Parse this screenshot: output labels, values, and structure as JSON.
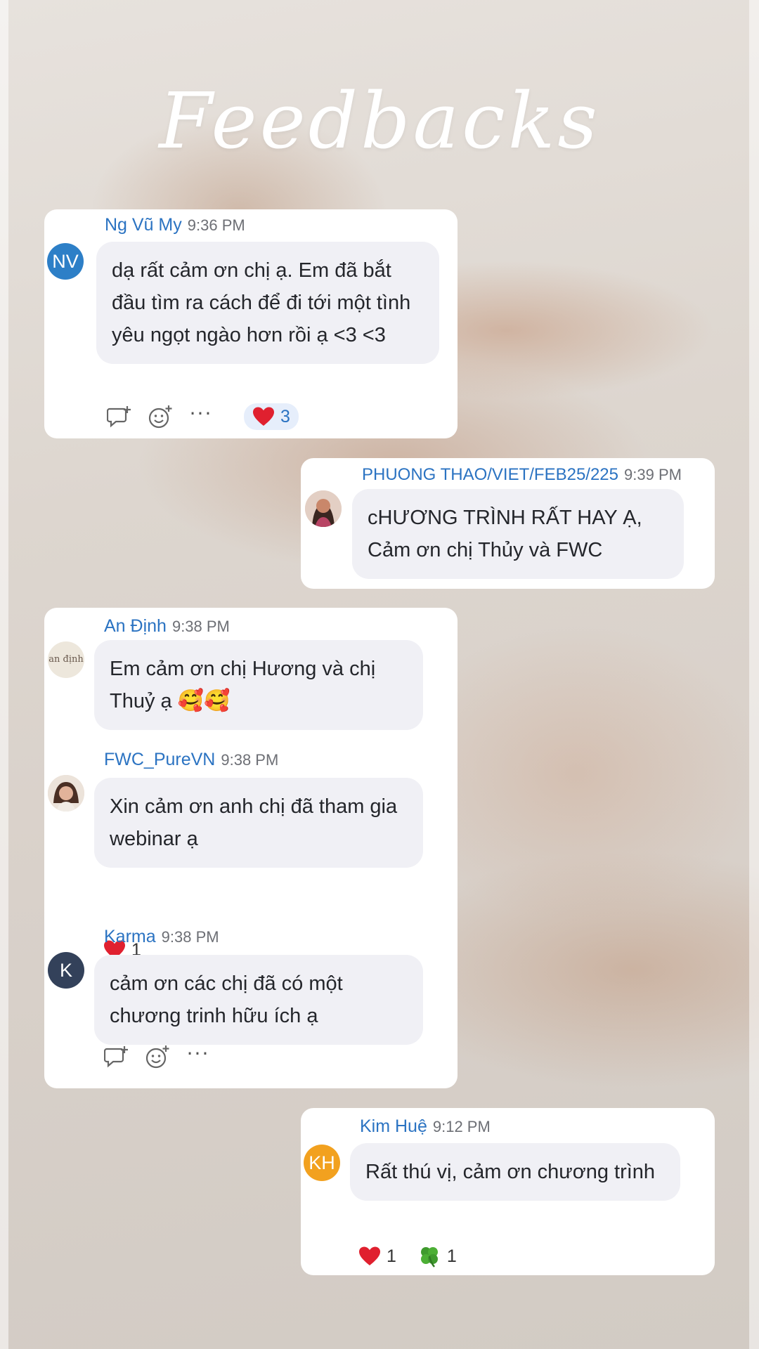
{
  "title": "Feedbacks",
  "messages": [
    {
      "name": "Ng Vũ My",
      "time": "9:36 PM",
      "initials": "NV",
      "avatar_color": "#2d7fc7",
      "text": "dạ rất cảm ơn chị ạ. Em đã bắt đầu tìm ra cách để đi tới một tình yêu ngọt ngào hơn rồi ạ <3 <3",
      "reaction_count": "3"
    },
    {
      "name": "PHUONG THAO/VIET/FEB25/225",
      "time": "9:39 PM",
      "text": "cHƯƠNG TRÌNH RẤT HAY Ạ, Cảm ơn chị Thủy và FWC"
    },
    {
      "name": "An Định",
      "time": "9:38 PM",
      "avatar_text": "an định",
      "text": "Em cảm ơn chị Hương và chị Thuỷ ạ",
      "emoji": "🥰🥰"
    },
    {
      "name": "FWC_PureVN",
      "time": "9:38 PM",
      "text": "Xin cảm ơn anh chị đã tham gia webinar ạ",
      "reaction_count": "1"
    },
    {
      "name": "Karma",
      "time": "9:38 PM",
      "initials": "K",
      "avatar_color": "#33415a",
      "text": "cảm ơn các chị đã có một chương trinh hữu ích ạ"
    },
    {
      "name": "Kim Huệ",
      "time": "9:12 PM",
      "initials": "KH",
      "avatar_color": "#f2a11f",
      "text": "Rất thú vị, cảm ơn chương trình",
      "heart_count": "1",
      "clover_count": "1"
    }
  ],
  "actions": {
    "more": "···"
  },
  "colors": {
    "name": "#2b73c2",
    "bubble": "#f0f0f5",
    "heart": "#e0202f",
    "clover": "#3f9a2e"
  }
}
